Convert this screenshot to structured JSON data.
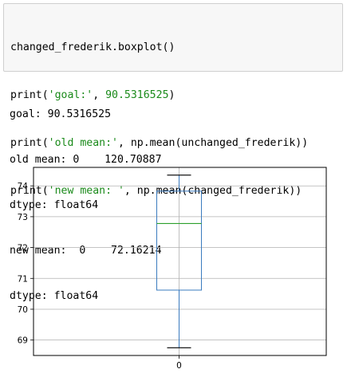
{
  "code_cell": {
    "line1": "changed_frederik.boxplot()",
    "line2_fn": "print(",
    "line2_str": "'goal:'",
    "line2_sep": ", ",
    "line2_num": "90.5316525",
    "line2_end": ")",
    "line3_fn": "print(",
    "line3_str": "'old mean:'",
    "line3_rest": ", np.mean(unchanged_frederik))",
    "line4_fn": "print(",
    "line4_str": "'new mean: '",
    "line4_rest": ", np.mean(changed_frederik))"
  },
  "output": {
    "lines": [
      "goal: 90.5316525",
      "old mean: 0    120.70887",
      "dtype: float64",
      "new mean:  0    72.16214",
      "dtype: float64"
    ]
  },
  "chart_data": {
    "type": "box",
    "categories": [
      "0"
    ],
    "box": {
      "whislo": 68.75,
      "q1": 70.62,
      "med": 72.78,
      "q3": 73.83,
      "whishi": 74.35
    },
    "ylim": [
      68.5,
      74.6
    ],
    "yticks": [
      69,
      70,
      71,
      72,
      73,
      74
    ],
    "grid": true,
    "colors": {
      "box": "#3b7bbf",
      "median": "#2ca02c",
      "whisker": "#3b7bbf",
      "cap": "#000000",
      "grid": "#b0b0b0"
    }
  }
}
